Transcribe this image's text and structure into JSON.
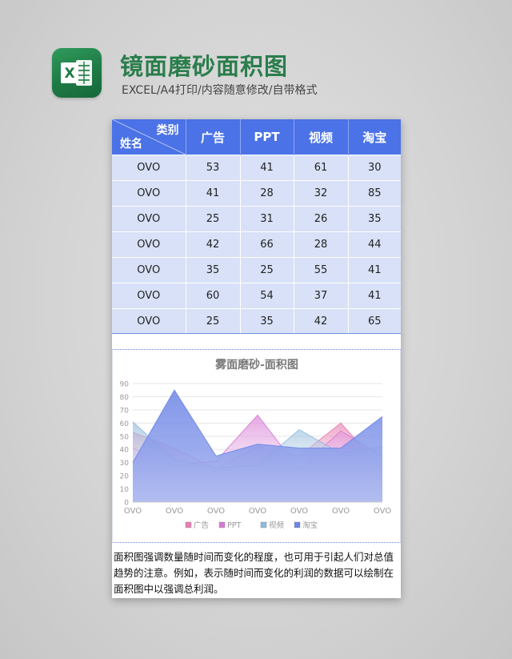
{
  "header": {
    "title": "镜面磨砂面积图",
    "subtitle": "EXCEL/A4打印/内容随意修改/自带格式",
    "logo_icon": "excel-icon",
    "logo_letter": "X"
  },
  "table": {
    "corner_top": "类别",
    "corner_bottom": "姓名",
    "columns": [
      "广告",
      "PPT",
      "视频",
      "淘宝"
    ],
    "rows": [
      {
        "name": "OVO",
        "values": [
          53,
          41,
          61,
          30
        ]
      },
      {
        "name": "OVO",
        "values": [
          41,
          28,
          32,
          85
        ]
      },
      {
        "name": "OVO",
        "values": [
          25,
          31,
          26,
          35
        ]
      },
      {
        "name": "OVO",
        "values": [
          42,
          66,
          28,
          44
        ]
      },
      {
        "name": "OVO",
        "values": [
          35,
          25,
          55,
          41
        ]
      },
      {
        "name": "OVO",
        "values": [
          60,
          54,
          37,
          41
        ]
      },
      {
        "name": "OVO",
        "values": [
          25,
          35,
          42,
          65
        ]
      }
    ]
  },
  "chart_data": {
    "type": "area",
    "title": "雾面磨砂-面积图",
    "categories": [
      "OVO",
      "OVO",
      "OVO",
      "OVO",
      "OVO",
      "OVO",
      "OVO"
    ],
    "series": [
      {
        "name": "广告",
        "values": [
          53,
          41,
          25,
          42,
          35,
          60,
          25
        ],
        "color": "#e77fb0"
      },
      {
        "name": "PPT",
        "values": [
          41,
          28,
          31,
          66,
          25,
          54,
          35
        ],
        "color": "#d77ad4"
      },
      {
        "name": "视频",
        "values": [
          61,
          32,
          26,
          28,
          55,
          37,
          42
        ],
        "color": "#8fb8dc"
      },
      {
        "name": "淘宝",
        "values": [
          30,
          85,
          35,
          44,
          41,
          41,
          65
        ],
        "color": "#6d85e6"
      }
    ],
    "ylim": [
      0,
      90
    ],
    "yticks": [
      0,
      10,
      20,
      30,
      40,
      50,
      60,
      70,
      80,
      90
    ],
    "grid": true,
    "legend": "bottom"
  },
  "description": "面积图强调数量随时间而变化的程度，也可用于引起人们对总值趋势的注意。例如，表示随时间而变化的利润的数据可以绘制在面积图中以强调总利润。"
}
